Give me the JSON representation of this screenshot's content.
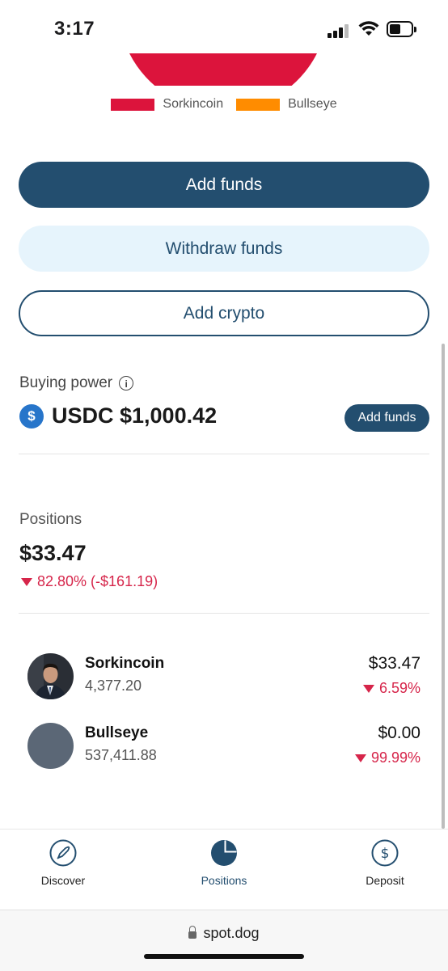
{
  "status_bar": {
    "time": "3:17"
  },
  "legend": [
    {
      "label": "Sorkincoin",
      "color": "#dc143c"
    },
    {
      "label": "Bullseye",
      "color": "#ff8c00"
    }
  ],
  "buttons": {
    "add_funds": "Add funds",
    "withdraw_funds": "Withdraw funds",
    "add_crypto": "Add crypto"
  },
  "buying_power": {
    "label": "Buying power",
    "info_icon": "info-icon",
    "currency_icon": "usdc-icon",
    "amount": "USDC $1,000.42",
    "add_funds": "Add funds"
  },
  "positions": {
    "label": "Positions",
    "value": "$33.47",
    "change": "82.80% (-$161.19)",
    "items": [
      {
        "name": "Sorkincoin",
        "qty": "4,377.20",
        "price": "$33.47",
        "change": "6.59%"
      },
      {
        "name": "Bullseye",
        "qty": "537,411.88",
        "price": "$0.00",
        "change": "99.99%"
      }
    ]
  },
  "nav": [
    {
      "label": "Discover",
      "icon": "rocket-icon"
    },
    {
      "label": "Positions",
      "icon": "pie-chart-icon"
    },
    {
      "label": "Deposit",
      "icon": "dollar-coin-icon"
    }
  ],
  "browser": {
    "url": "spot.dog"
  },
  "colors": {
    "primary": "#234e6f",
    "negative": "#d6254a",
    "pie": "#dc143c"
  }
}
